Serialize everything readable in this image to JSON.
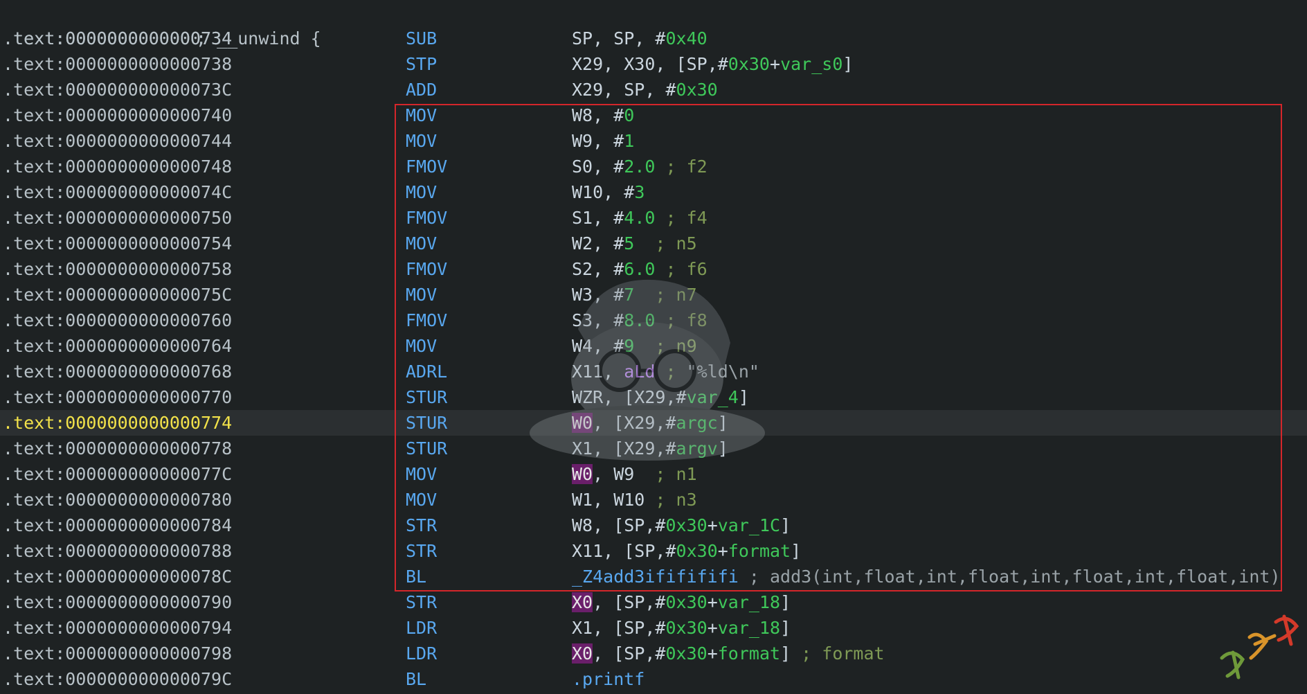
{
  "header": {
    "address": ".text:0000000000000734",
    "comment": " ; __unwind {"
  },
  "rows": [
    {
      "address": ".text:0000000000000734",
      "mnemonic": "SUB",
      "operands": [
        {
          "t": "SP, SP, #",
          "c": "reg"
        },
        {
          "t": "0x40",
          "c": "num"
        }
      ]
    },
    {
      "address": ".text:0000000000000738",
      "mnemonic": "STP",
      "operands": [
        {
          "t": "X29, X30, [SP,#",
          "c": "reg"
        },
        {
          "t": "0x30",
          "c": "num"
        },
        {
          "t": "+",
          "c": "reg"
        },
        {
          "t": "var_s0",
          "c": "var"
        },
        {
          "t": "]",
          "c": "reg"
        }
      ]
    },
    {
      "address": ".text:000000000000073C",
      "mnemonic": "ADD",
      "operands": [
        {
          "t": "X29, SP, #",
          "c": "reg"
        },
        {
          "t": "0x30",
          "c": "num"
        }
      ]
    },
    {
      "address": ".text:0000000000000740",
      "mnemonic": "MOV",
      "operands": [
        {
          "t": "W8, #",
          "c": "reg"
        },
        {
          "t": "0",
          "c": "num"
        }
      ]
    },
    {
      "address": ".text:0000000000000744",
      "mnemonic": "MOV",
      "operands": [
        {
          "t": "W9, #",
          "c": "reg"
        },
        {
          "t": "1",
          "c": "num"
        }
      ]
    },
    {
      "address": ".text:0000000000000748",
      "mnemonic": "FMOV",
      "operands": [
        {
          "t": "S0, #",
          "c": "reg"
        },
        {
          "t": "2.0",
          "c": "num"
        },
        {
          "t": " ; f2",
          "c": "cmt"
        }
      ]
    },
    {
      "address": ".text:000000000000074C",
      "mnemonic": "MOV",
      "operands": [
        {
          "t": "W10, #",
          "c": "reg"
        },
        {
          "t": "3",
          "c": "num"
        }
      ]
    },
    {
      "address": ".text:0000000000000750",
      "mnemonic": "FMOV",
      "operands": [
        {
          "t": "S1, #",
          "c": "reg"
        },
        {
          "t": "4.0",
          "c": "num"
        },
        {
          "t": " ; f4",
          "c": "cmt"
        }
      ]
    },
    {
      "address": ".text:0000000000000754",
      "mnemonic": "MOV",
      "operands": [
        {
          "t": "W2, #",
          "c": "reg"
        },
        {
          "t": "5",
          "c": "num"
        },
        {
          "t": "  ; n5",
          "c": "cmt"
        }
      ]
    },
    {
      "address": ".text:0000000000000758",
      "mnemonic": "FMOV",
      "operands": [
        {
          "t": "S2, #",
          "c": "reg"
        },
        {
          "t": "6.0",
          "c": "num"
        },
        {
          "t": " ; f6",
          "c": "cmt"
        }
      ]
    },
    {
      "address": ".text:000000000000075C",
      "mnemonic": "MOV",
      "operands": [
        {
          "t": "W3, #",
          "c": "reg"
        },
        {
          "t": "7",
          "c": "num"
        },
        {
          "t": "  ; n7",
          "c": "cmt"
        }
      ]
    },
    {
      "address": ".text:0000000000000760",
      "mnemonic": "FMOV",
      "operands": [
        {
          "t": "S3, #",
          "c": "reg"
        },
        {
          "t": "8.0",
          "c": "num"
        },
        {
          "t": " ; f8",
          "c": "cmt"
        }
      ]
    },
    {
      "address": ".text:0000000000000764",
      "mnemonic": "MOV",
      "operands": [
        {
          "t": "W4, #",
          "c": "reg"
        },
        {
          "t": "9",
          "c": "num"
        },
        {
          "t": "  ; n9",
          "c": "cmt"
        }
      ]
    },
    {
      "address": ".text:0000000000000768",
      "mnemonic": "ADRL",
      "operands": [
        {
          "t": "X11, ",
          "c": "reg"
        },
        {
          "t": "aLd",
          "c": "sym"
        },
        {
          "t": " ; ",
          "c": "cmt"
        },
        {
          "t": "\"%ld\\n\"",
          "c": "str"
        }
      ]
    },
    {
      "address": ".text:0000000000000770",
      "mnemonic": "STUR",
      "operands": [
        {
          "t": "WZR, [X29,#",
          "c": "reg"
        },
        {
          "t": "var_4",
          "c": "var"
        },
        {
          "t": "]",
          "c": "reg"
        }
      ]
    },
    {
      "address": ".text:0000000000000774",
      "mnemonic": "STUR",
      "current": true,
      "operands": [
        {
          "t": "W0",
          "c": "hl"
        },
        {
          "t": ", [X29,#",
          "c": "reg"
        },
        {
          "t": "argc",
          "c": "var"
        },
        {
          "t": "]",
          "c": "reg"
        }
      ]
    },
    {
      "address": ".text:0000000000000778",
      "mnemonic": "STUR",
      "operands": [
        {
          "t": "X1, [X29,#",
          "c": "reg"
        },
        {
          "t": "argv",
          "c": "var"
        },
        {
          "t": "]",
          "c": "reg"
        }
      ]
    },
    {
      "address": ".text:000000000000077C",
      "mnemonic": "MOV",
      "operands": [
        {
          "t": "W0",
          "c": "hl"
        },
        {
          "t": ", W9",
          "c": "reg"
        },
        {
          "t": "  ; n1",
          "c": "cmt"
        }
      ]
    },
    {
      "address": ".text:0000000000000780",
      "mnemonic": "MOV",
      "operands": [
        {
          "t": "W1, W10",
          "c": "reg"
        },
        {
          "t": " ; n3",
          "c": "cmt"
        }
      ]
    },
    {
      "address": ".text:0000000000000784",
      "mnemonic": "STR",
      "operands": [
        {
          "t": "W8, [SP,#",
          "c": "reg"
        },
        {
          "t": "0x30",
          "c": "num"
        },
        {
          "t": "+",
          "c": "reg"
        },
        {
          "t": "var_1C",
          "c": "var"
        },
        {
          "t": "]",
          "c": "reg"
        }
      ]
    },
    {
      "address": ".text:0000000000000788",
      "mnemonic": "STR",
      "operands": [
        {
          "t": "X11, [SP,#",
          "c": "reg"
        },
        {
          "t": "0x30",
          "c": "num"
        },
        {
          "t": "+",
          "c": "reg"
        },
        {
          "t": "format",
          "c": "var"
        },
        {
          "t": "]",
          "c": "reg"
        }
      ]
    },
    {
      "address": ".text:000000000000078C",
      "mnemonic": "BL",
      "operands": [
        {
          "t": "_Z4add3ififififi",
          "c": "fn"
        },
        {
          "t": " ; add3(int,float,int,float,int,float,int,float,int)",
          "c": "str"
        }
      ]
    },
    {
      "address": ".text:0000000000000790",
      "mnemonic": "STR",
      "operands": [
        {
          "t": "X0",
          "c": "hl"
        },
        {
          "t": ", [SP,#",
          "c": "reg"
        },
        {
          "t": "0x30",
          "c": "num"
        },
        {
          "t": "+",
          "c": "reg"
        },
        {
          "t": "var_18",
          "c": "var"
        },
        {
          "t": "]",
          "c": "reg"
        }
      ]
    },
    {
      "address": ".text:0000000000000794",
      "mnemonic": "LDR",
      "operands": [
        {
          "t": "X1, [SP,#",
          "c": "reg"
        },
        {
          "t": "0x30",
          "c": "num"
        },
        {
          "t": "+",
          "c": "reg"
        },
        {
          "t": "var_18",
          "c": "var"
        },
        {
          "t": "]",
          "c": "reg"
        }
      ]
    },
    {
      "address": ".text:0000000000000798",
      "mnemonic": "LDR",
      "operands": [
        {
          "t": "X0",
          "c": "hl"
        },
        {
          "t": ", [SP,#",
          "c": "reg"
        },
        {
          "t": "0x30",
          "c": "num"
        },
        {
          "t": "+",
          "c": "reg"
        },
        {
          "t": "format",
          "c": "var"
        },
        {
          "t": "]",
          "c": "reg"
        },
        {
          "t": " ; format",
          "c": "cmt"
        }
      ]
    },
    {
      "address": ".text:000000000000079C",
      "mnemonic": "BL",
      "operands": [
        {
          "t": ".printf",
          "c": "fn"
        }
      ]
    }
  ],
  "colors": {
    "background": "#1e2223",
    "current_line": "#2b2f31",
    "mnemonic": "#59a8f0",
    "number": "#3fc85a",
    "comment": "#7f9a55",
    "highlight": "#6a1f6a",
    "selection_box": "#d4262b",
    "current_address": "#f2e24a"
  },
  "decorations": {
    "watermark_icon": "cartoon-detective-watermark-icon",
    "signature_icon": "handwritten-signature-icon",
    "signature_text": "夏洛魂"
  }
}
